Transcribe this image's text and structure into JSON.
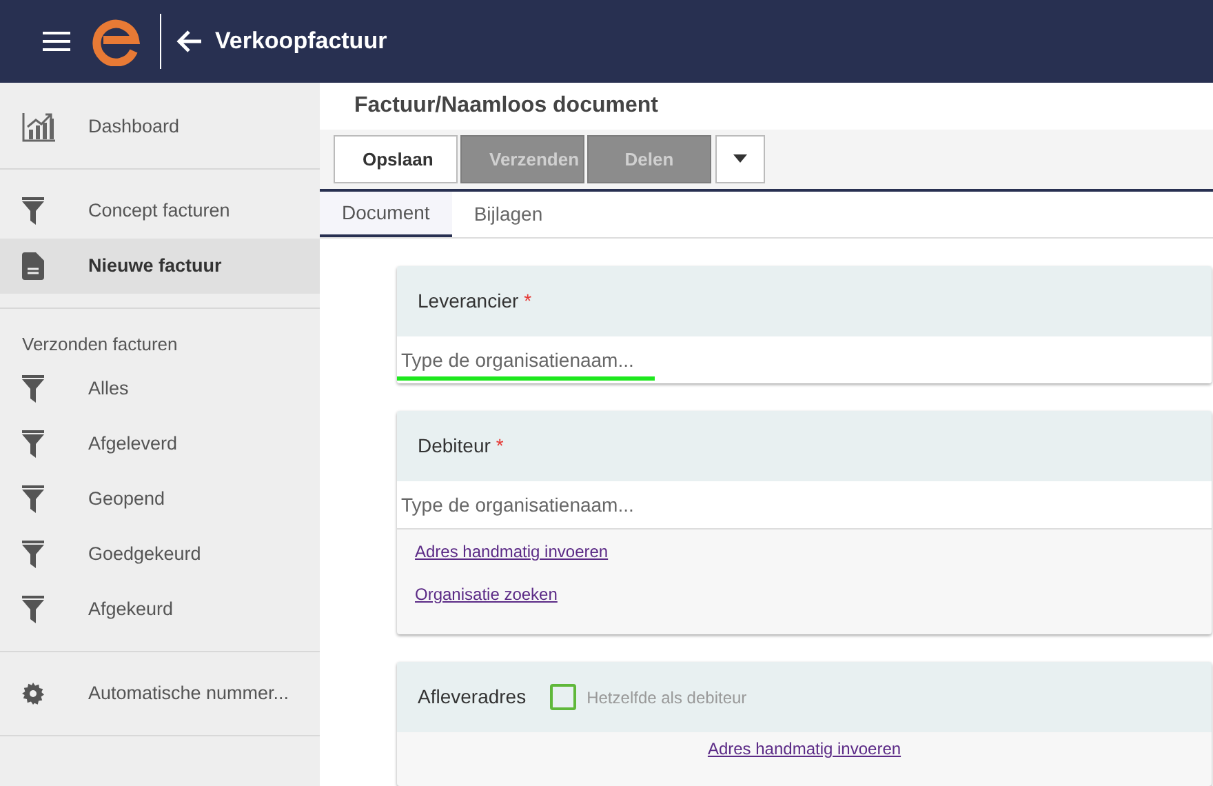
{
  "header": {
    "title": "Verkoopfactuur"
  },
  "sidebar": {
    "groups": [
      {
        "items": [
          {
            "label": "Dashboard",
            "kind": "chart",
            "selected": false
          }
        ]
      },
      {
        "items": [
          {
            "label": "Concept facturen",
            "kind": "filter",
            "selected": false
          },
          {
            "label": "Nieuwe factuur",
            "kind": "document",
            "selected": true
          }
        ]
      },
      {
        "heading": "Verzonden facturen",
        "items": [
          {
            "label": "Alles",
            "kind": "filter",
            "selected": false
          },
          {
            "label": "Afgeleverd",
            "kind": "filter",
            "selected": false
          },
          {
            "label": "Geopend",
            "kind": "filter",
            "selected": false
          },
          {
            "label": "Goedgekeurd",
            "kind": "filter",
            "selected": false
          },
          {
            "label": "Afgekeurd",
            "kind": "filter",
            "selected": false
          }
        ]
      },
      {
        "items": [
          {
            "label": "Automatische nummer...",
            "kind": "gear",
            "selected": false
          }
        ]
      }
    ]
  },
  "document_title": "Factuur/Naamloos document",
  "toolbar": {
    "buttons": [
      {
        "label": "Opslaan",
        "disabled": false
      },
      {
        "label": "Verzenden",
        "disabled": true
      },
      {
        "label": "Delen",
        "disabled": true
      }
    ]
  },
  "tabs": [
    {
      "label": "Document",
      "selected": true
    },
    {
      "label": "Bijlagen",
      "selected": false
    }
  ],
  "sections": [
    {
      "kind": "organisation",
      "title": "Leverancier",
      "required_mark": "*",
      "placeholder": "Type de organisatienaam...",
      "focused": true
    },
    {
      "kind": "organisation",
      "title": "Debiteur",
      "required_mark": "*",
      "placeholder": "Type de organisatienaam...",
      "focused": false,
      "links": [
        "Adres handmatig invoeren",
        "Organisatie zoeken"
      ]
    },
    {
      "kind": "address",
      "title": "Afleveradres",
      "checkbox": {
        "label": "Hetzelfde als debiteur",
        "checked": false
      },
      "links": [
        "Adres handmatig invoeren"
      ]
    }
  ]
}
